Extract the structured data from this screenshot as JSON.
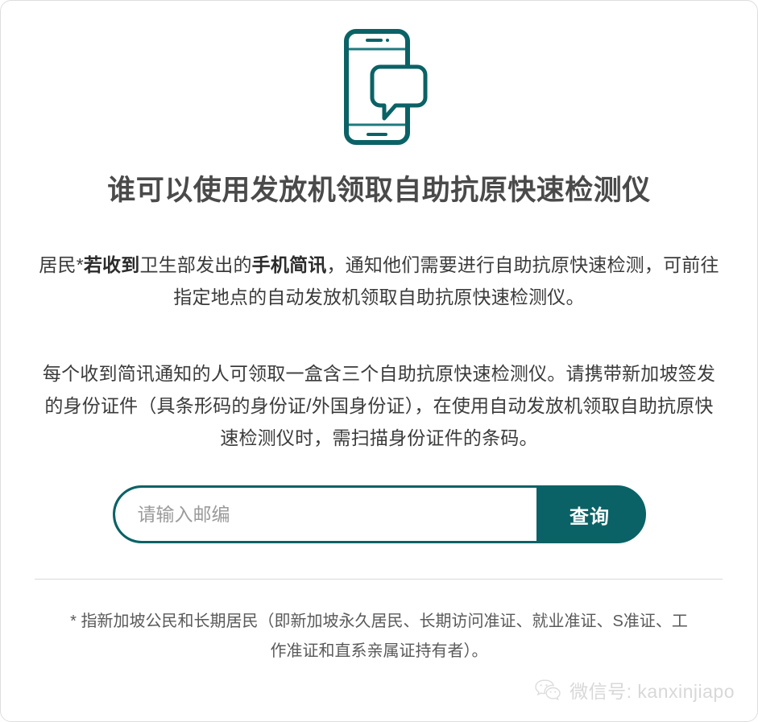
{
  "card": {
    "hero_icon": "phone-message-icon",
    "accent_color": "#0b6266",
    "title_color": "#4a4a4a",
    "divider_color": "#d9d9d9"
  },
  "title": "谁可以使用发放机领取自助抗原快速检测仪",
  "paragraphs": [
    {
      "segments": [
        {
          "text": "居民*",
          "bold": false
        },
        {
          "text": "若收到",
          "bold": true
        },
        {
          "text": "卫生部发出的",
          "bold": false
        },
        {
          "text": "手机简讯",
          "bold": true
        },
        {
          "text": "，通知他们需要进行自助抗原快速检测，可前往指定地点的自动发放机领取自助抗原快速检测仪。",
          "bold": false
        }
      ]
    },
    {
      "segments": [
        {
          "text": "每个收到简讯通知的人可领取一盒含三个自助抗原快速检测仪。请携带新加坡签发的身份证件（具条形码的身份证/外国身份证），在使用自动发放机领取自助抗原快速检测仪时，需扫描身份证件的条码。",
          "bold": false
        }
      ]
    }
  ],
  "search": {
    "placeholder": "请输入邮编",
    "value": "",
    "button_label": "查询"
  },
  "footnote": "* 指新加坡公民和长期居民（即新加坡永久居民、长期访问准证、就业准证、S准证、工作准证和直系亲属证持有者）。",
  "watermark": {
    "icon": "wechat-icon",
    "text": "微信号: kanxinjiapo"
  }
}
